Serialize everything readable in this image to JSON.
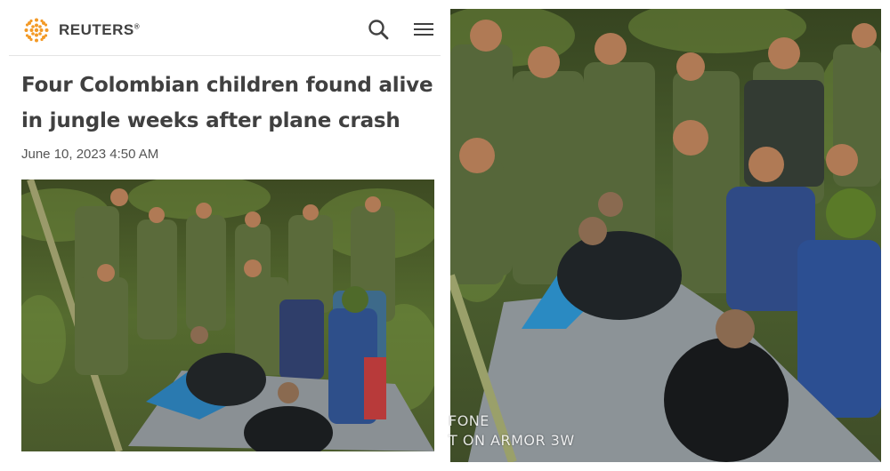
{
  "brand": {
    "name": "REUTERS",
    "reg_mark": "®",
    "accent": "#f39a27"
  },
  "header": {
    "search_icon": "search-icon",
    "menu_icon": "hamburger-menu-icon"
  },
  "article": {
    "headline": "Four Colombian children found alive in jungle weeks after plane crash",
    "date": "June 10, 2023 4:50 AM"
  },
  "photo_overlay": {
    "line1": "FONE",
    "line2": "T ON ARMOR 3W"
  },
  "colors": {
    "headline": "#404040",
    "jungle": "#4a5a2c",
    "uniform": "#5a6a3a",
    "tarp": "#8a9094"
  }
}
